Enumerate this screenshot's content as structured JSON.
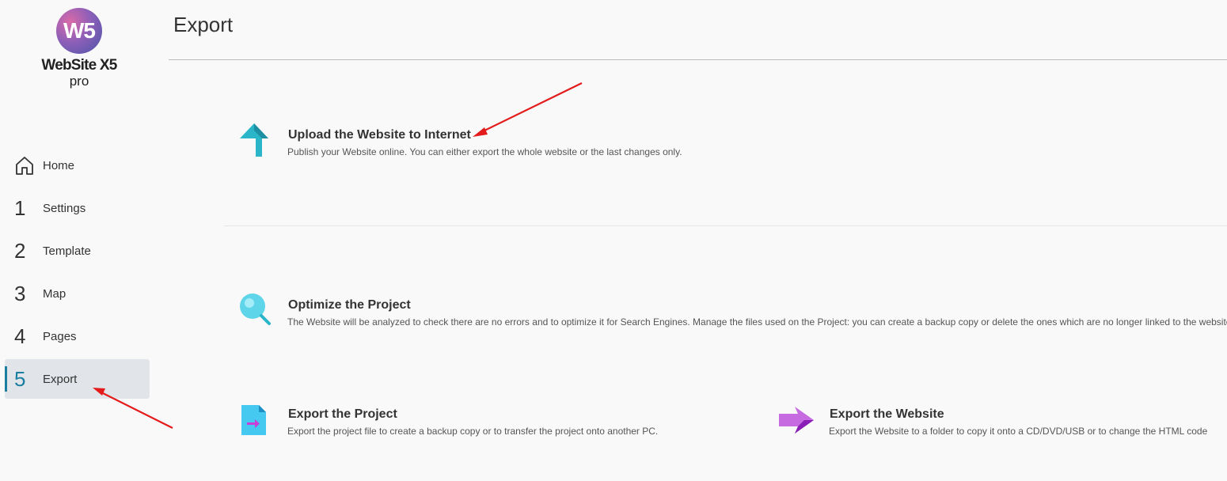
{
  "logo": {
    "mark": "W5",
    "name": "WebSite X5",
    "edition": "pro"
  },
  "nav": {
    "items": [
      {
        "num": "",
        "icon": "home-icon",
        "label": "Home"
      },
      {
        "num": "1",
        "label": "Settings"
      },
      {
        "num": "2",
        "label": "Template"
      },
      {
        "num": "3",
        "label": "Map"
      },
      {
        "num": "4",
        "label": "Pages"
      },
      {
        "num": "5",
        "label": "Export",
        "active": true
      }
    ]
  },
  "page": {
    "title": "Export"
  },
  "actions": {
    "upload": {
      "icon": "upload-arrow-icon",
      "title": "Upload the Website to Internet",
      "desc": "Publish your Website online. You can either export the whole website or the last changes only."
    },
    "optimize": {
      "icon": "magnifier-icon",
      "title": "Optimize the Project",
      "desc": "The Website will be analyzed to check there are no errors and to optimize it for Search Engines. Manage the files used on the Project: you can create a backup copy or delete the ones which are no longer linked to the website"
    },
    "export_project": {
      "icon": "export-file-icon",
      "title": "Export the Project",
      "desc": "Export the project file to create a backup copy or to transfer the project onto another PC."
    },
    "export_website": {
      "icon": "export-arrow-icon",
      "title": "Export the Website",
      "desc": "Export the Website to a folder to copy it onto a CD/DVD/USB or to change the HTML code"
    }
  },
  "colors": {
    "accent": "#1a7ea0",
    "annotation": "#e31b1b",
    "upload_icon": "#2bb5c9",
    "optimize_icon": "#5fd5ea",
    "export_project_icon": "#45c9f0",
    "export_website_icon": "#b040d6"
  }
}
